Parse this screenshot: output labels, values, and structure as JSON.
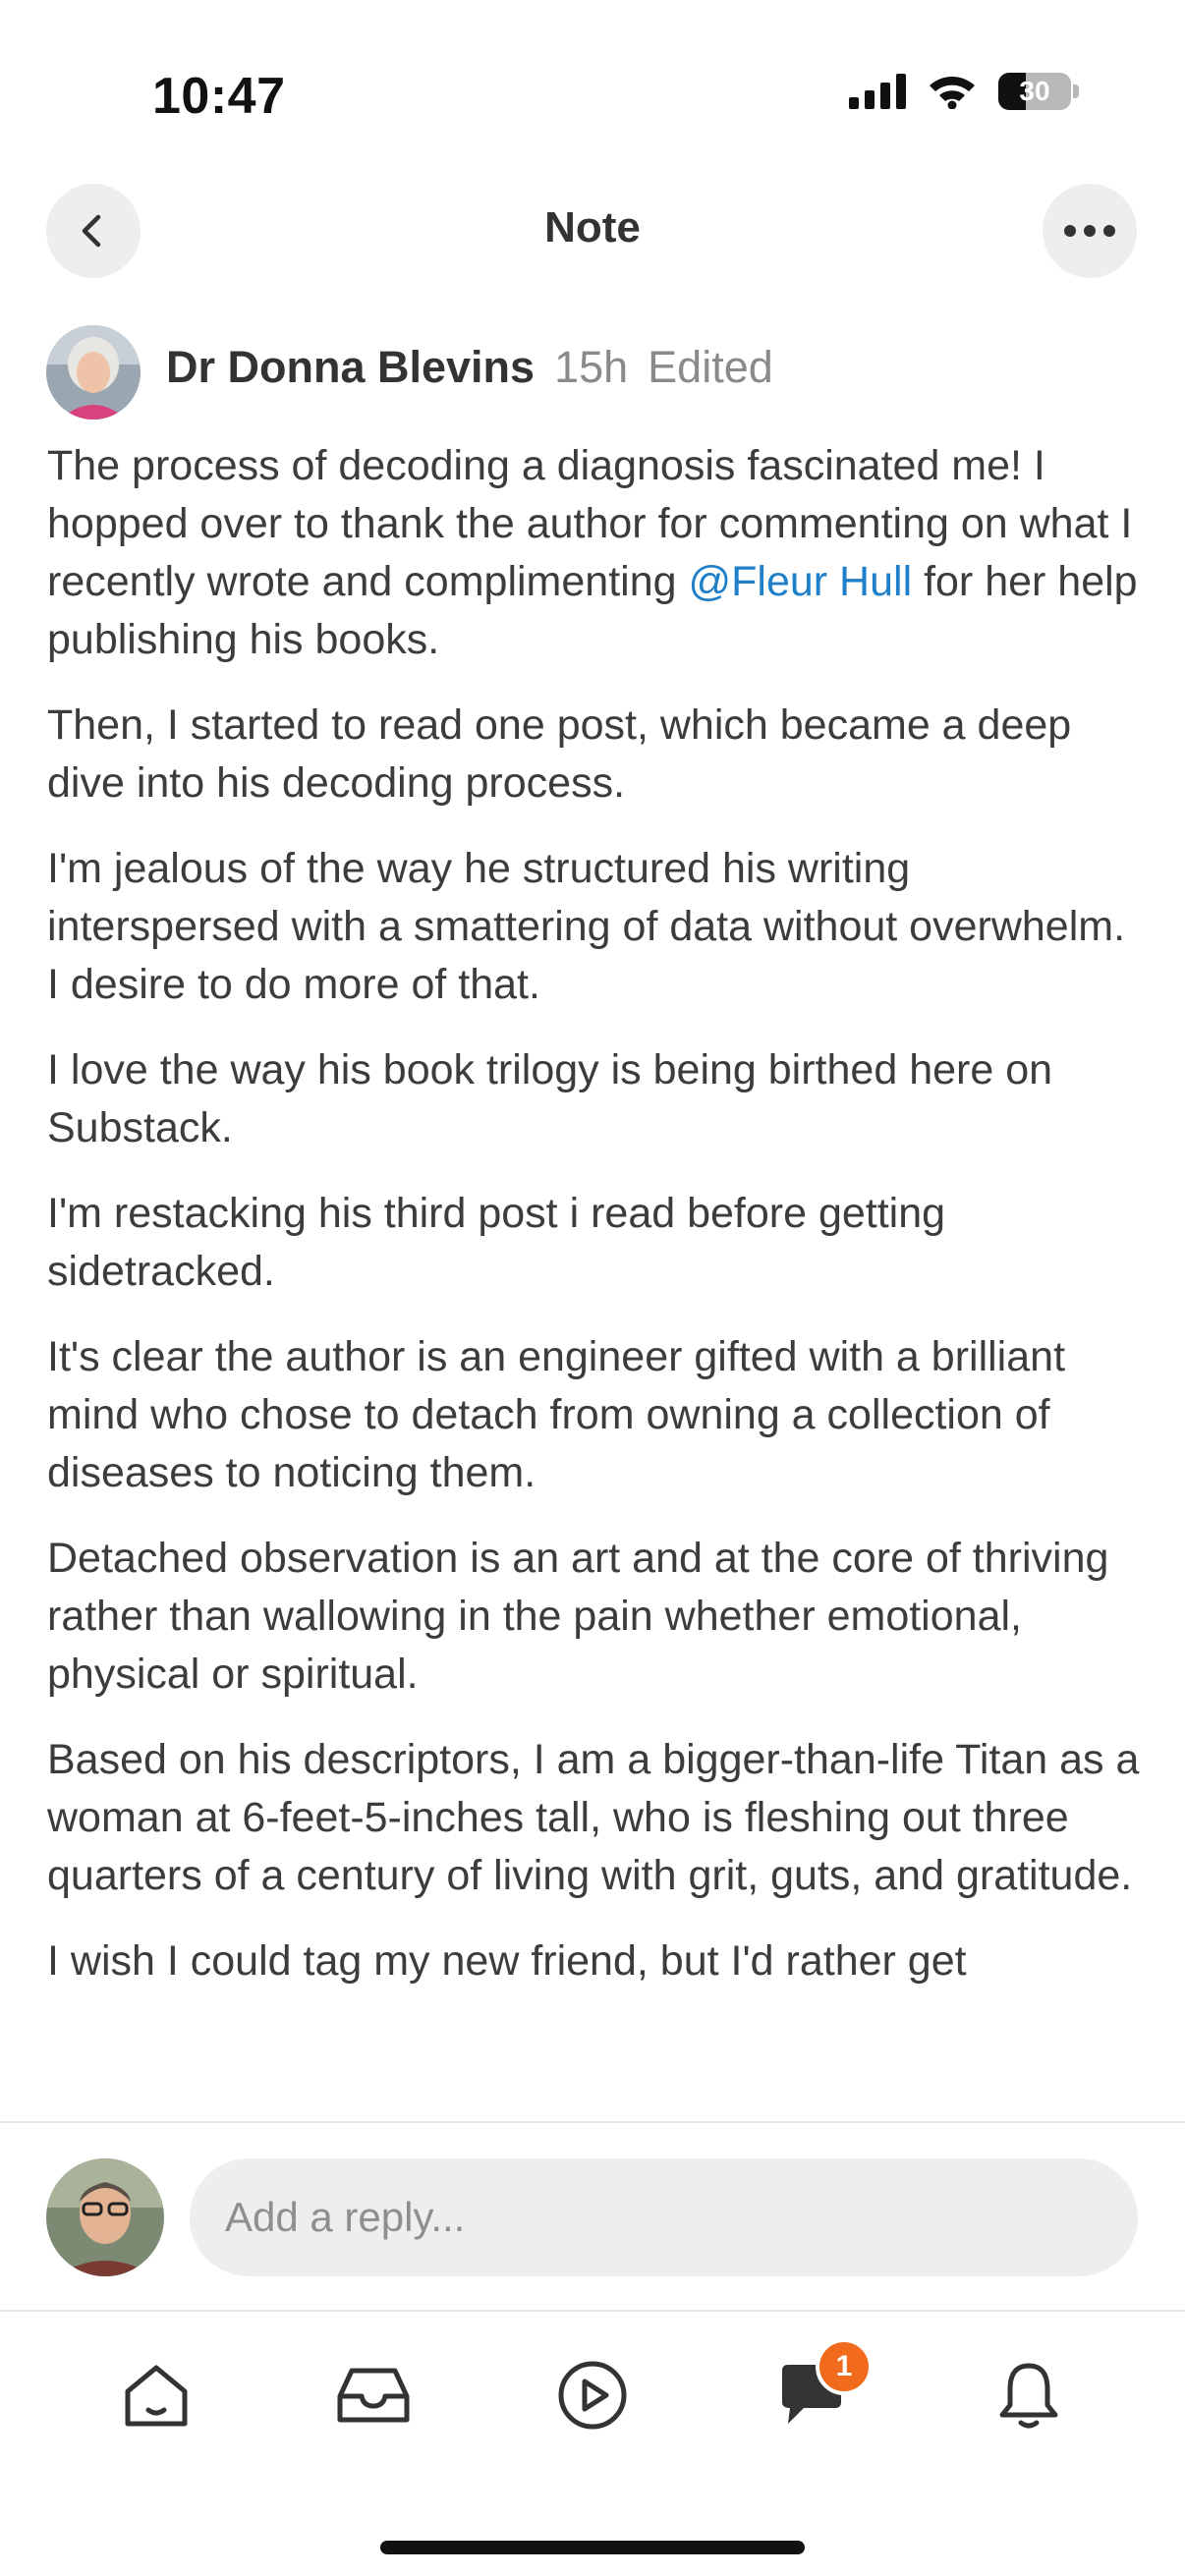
{
  "status_bar": {
    "time": "10:47",
    "battery": "30"
  },
  "header": {
    "title": "Note"
  },
  "author": {
    "name": "Dr Donna Blevins",
    "time": "15h",
    "edited": "Edited"
  },
  "post": {
    "p1_before": "The process of decoding a diagnosis fascinated me! I hopped over to thank the author for commenting on what I recently wrote and complimenting ",
    "p1_mention": "@Fleur Hull",
    "p1_after": " for her help publishing his books.",
    "p2": "Then, I started to read one post, which became a deep dive into his decoding process.",
    "p3": "I'm jealous of the way he structured his writing interspersed with a smattering of data without overwhelm. I desire to do more of that.",
    "p4": "I love the way his book trilogy is being birthed here on Substack.",
    "p5": "I'm restacking his third post i read before getting sidetracked.",
    "p6": "It's clear the author is an engineer gifted with a brilliant mind who chose to detach from owning a collection of diseases to noticing them.",
    "p7": "Detached observation is an art and at the core of thriving rather than wallowing in the pain whether emotional, physical or spiritual.",
    "p8": "Based on his descriptors, I am a bigger-than-life Titan as a woman at 6-feet-5-inches tall, who is fleshing out three quarters of a century of living with grit, guts, and gratitude.",
    "p9": "I wish I could tag my new friend, but I'd rather get"
  },
  "reply": {
    "placeholder": "Add a reply..."
  },
  "tab_bar": {
    "items": [
      "home-icon",
      "inbox-icon",
      "play-icon",
      "chat-icon",
      "bell-icon"
    ],
    "chat_badge": "1"
  },
  "colors": {
    "mention": "#1f7fc9",
    "badge": "#f26a1b"
  }
}
